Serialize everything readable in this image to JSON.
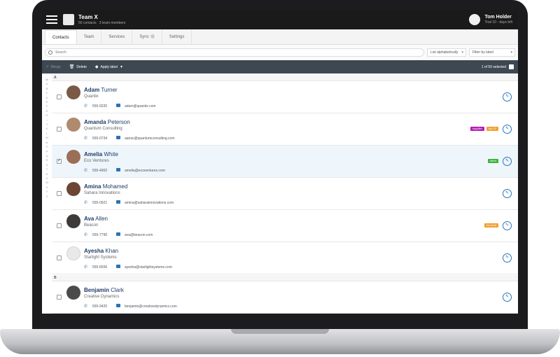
{
  "header": {
    "team_name": "Team X",
    "contacts_count": "50 contacts",
    "members_count": "3 team members",
    "user_name": "Tom Holder",
    "trial_text": "Trial 10 - days left"
  },
  "tabs": [
    {
      "label": "Contacts"
    },
    {
      "label": "Team"
    },
    {
      "label": "Services"
    },
    {
      "label": "Sync"
    },
    {
      "label": "Settings"
    }
  ],
  "search": {
    "placeholder": "Search"
  },
  "sort": {
    "value": "List alphabetically"
  },
  "filter": {
    "value": "Filter by label"
  },
  "toolbar": {
    "merge_label": "Merge",
    "delete_label": "Delete",
    "apply_label": "Apply label",
    "selected_text": "1 of 50 selected"
  },
  "alphabet": [
    "All",
    "A",
    "B",
    "C",
    "D",
    "E",
    "F",
    "G",
    "H",
    "I",
    "J",
    "K",
    "L",
    "M",
    "N",
    "O",
    "P",
    "Q",
    "R",
    "S",
    "T",
    "U",
    "V",
    "W",
    "X",
    "Y",
    "Z"
  ],
  "sections": [
    {
      "letter": "A"
    },
    {
      "letter": "B"
    }
  ],
  "contacts": [
    {
      "first": "Adam",
      "last": "Turner",
      "company": "Quantix",
      "phone": "555-9220",
      "email": "adam@quantix.com",
      "selected": false,
      "tags": []
    },
    {
      "first": "Amanda",
      "last": "Peterson",
      "company": "Quantum Consulting",
      "phone": "555-0734",
      "email": "aanav@quantumconsulting.com",
      "selected": false,
      "tags": [
        {
          "label": "supplier",
          "color": "#b51cb5"
        },
        {
          "label": "top 10",
          "color": "#f0a030"
        }
      ]
    },
    {
      "first": "Amelia",
      "last": "White",
      "company": "Eco Ventures",
      "phone": "555-4902",
      "email": "amelia@ecoventures.com",
      "selected": true,
      "tags": [
        {
          "label": "client",
          "color": "#3bb33b"
        }
      ]
    },
    {
      "first": "Amina",
      "last": "Mohamed",
      "company": "Sahara Innovations",
      "phone": "555-0921",
      "email": "amina@saharainnovations.com",
      "selected": false,
      "tags": []
    },
    {
      "first": "Ava",
      "last": "Allen",
      "company": "Beacon",
      "phone": "555-7790",
      "email": "ava@beacon.com",
      "selected": false,
      "tags": [
        {
          "label": "hot lead",
          "color": "#f0a030"
        }
      ]
    },
    {
      "first": "Ayesha",
      "last": "Khan",
      "company": "Starlight Systems",
      "phone": "555-6556",
      "email": "ayesha@starlightsystems.com",
      "selected": false,
      "tags": []
    },
    {
      "first": "Benjamin",
      "last": "Clark",
      "company": "Creative Dynamics",
      "phone": "555-9420",
      "email": "benjamin@creativedynamics.com",
      "selected": false,
      "tags": []
    }
  ],
  "colors": {
    "accent": "#2874b8",
    "header_bg": "#1a1a1a",
    "toolbar_bg": "#3d4852"
  }
}
